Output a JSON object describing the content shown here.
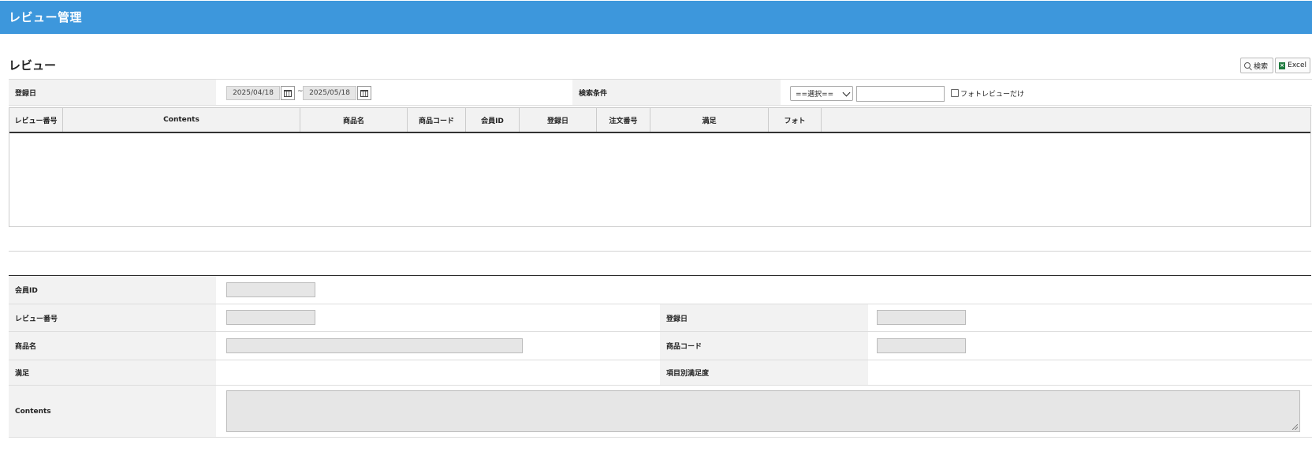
{
  "header": {
    "title": "レビュー管理"
  },
  "section": {
    "title": "レビュー"
  },
  "toolbar": {
    "search_label": "検索",
    "excel_label": "Excel"
  },
  "search": {
    "date_label": "登録日",
    "date_from": "2025/04/18",
    "date_sep": "~",
    "date_to": "2025/05/18",
    "condition_label": "検索条件",
    "condition_select": "==選択==",
    "condition_text": "",
    "photo_only_label": "フォトレビューだけ",
    "photo_only_checked": false
  },
  "grid": {
    "columns": [
      "レビュー番号",
      "Contents",
      "商品名",
      "商品コード",
      "会員ID",
      "登録日",
      "注文番号",
      "満足",
      "フォト"
    ],
    "rows": []
  },
  "detail": {
    "member_id_label": "会員ID",
    "review_no_label": "レビュー番号",
    "reg_date_label": "登録日",
    "product_name_label": "商品名",
    "product_code_label": "商品コード",
    "satisfaction_label": "満足",
    "item_satisfaction_label": "項目別満足度",
    "contents_label": "Contents",
    "member_id": "",
    "review_no": "",
    "reg_date": "",
    "product_name": "",
    "product_code": "",
    "contents": ""
  }
}
